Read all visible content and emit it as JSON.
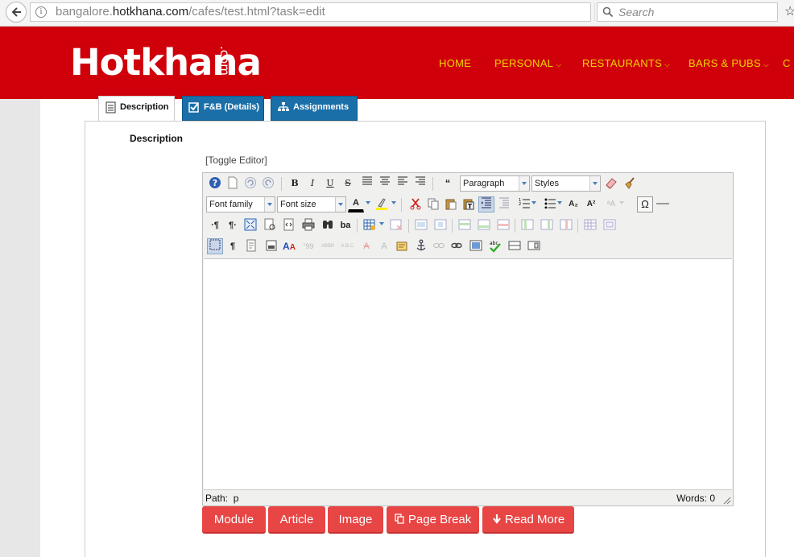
{
  "browser": {
    "url_prefix": "bangalore.",
    "url_host": "hotkhana.com",
    "url_path": "/cafes/test.html?task=edit",
    "search_placeholder": "Search",
    "info_glyph": "i",
    "reload_glyph": "⟳",
    "star_glyph": "☆"
  },
  "site": {
    "logo_text": "Hotkhana",
    "logo_suffix": ".com",
    "nav": [
      {
        "label": "HOME"
      },
      {
        "label": "PERSONAL"
      },
      {
        "label": "RESTAURANTS"
      },
      {
        "label": "BARS & PUBS"
      },
      {
        "label": "C"
      }
    ],
    "brand_color": "#d0000a",
    "nav_color": "#f0d400"
  },
  "tabs": [
    {
      "label": "Description",
      "icon": "document-icon"
    },
    {
      "label": "F&B (Details)",
      "icon": "checkbox-icon"
    },
    {
      "label": "Assignments",
      "icon": "org-chart-icon"
    }
  ],
  "form": {
    "field_label": "Description",
    "toggle_editor": "[Toggle Editor]"
  },
  "editor": {
    "format_value": "Paragraph",
    "styles_value": "Styles",
    "font_family_value": "Font family",
    "font_size_value": "Font size",
    "bold": "B",
    "italic": "I",
    "underline": "U",
    "strike": "S",
    "quote": "“",
    "subscript": "A₂",
    "superscript": "A²",
    "omega": "Ω",
    "pilcrow": "¶",
    "ltr": "·¶",
    "rtl": "¶·",
    "ba": "ba",
    "font_color": "A",
    "styleprops": "A",
    "abbr": "ABBR",
    "acronym": "A.B.C.",
    "cite": "“99",
    "path_label": "Path:",
    "path_value": "p",
    "words_label": "Words:",
    "words_value": "0"
  },
  "buttons": {
    "module": "Module",
    "article": "Article",
    "image": "Image",
    "page_break": "Page Break",
    "read_more": "Read More",
    "button_color": "#e84545"
  }
}
